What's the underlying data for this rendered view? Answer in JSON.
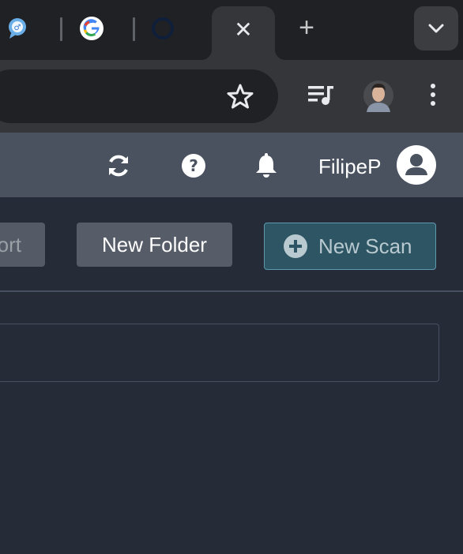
{
  "browser": {
    "tabs": [
      {
        "icon": "chat-bubble-favicon"
      },
      {
        "icon": "google-favicon"
      },
      {
        "icon": "circle-favicon"
      }
    ],
    "active_tab": {
      "close_label": "✕"
    },
    "new_tab_label": "+",
    "toolbar": {
      "bookmark_icon": "star-icon",
      "media_icon": "media-playlist-icon",
      "profile_icon": "profile-avatar",
      "menu_icon": "kebab-menu-icon"
    }
  },
  "app": {
    "header": {
      "refresh_icon": "refresh-icon",
      "help_icon": "help-icon",
      "notification_icon": "bell-icon",
      "username": "FilipeP",
      "avatar_icon": "user-avatar-icon"
    },
    "actions": {
      "import_label": "ort",
      "new_folder_label": "New Folder",
      "new_scan_label": "New Scan"
    }
  },
  "colors": {
    "tab_strip": "#202124",
    "toolbar": "#35363a",
    "app_header": "#4a5260",
    "background": "#252c38",
    "scan_button": "#2d5563"
  }
}
